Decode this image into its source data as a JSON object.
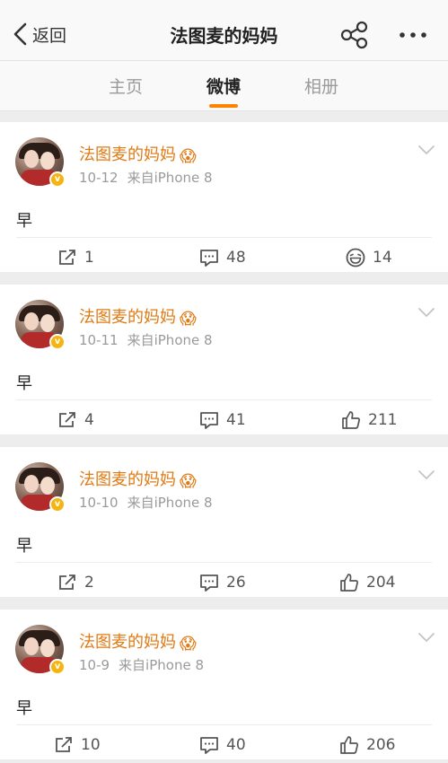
{
  "nav": {
    "back_label": "返回",
    "title": "法图麦的妈妈",
    "share_icon": "share-icon",
    "more_label": "•••"
  },
  "tabs": [
    {
      "label": "主页",
      "active": false
    },
    {
      "label": "微博",
      "active": true
    },
    {
      "label": "相册",
      "active": false
    }
  ],
  "accent_color": "#ff8200",
  "username_color": "#e07a14",
  "posts": [
    {
      "author": "法图麦的妈妈",
      "emoji": "😱",
      "date": "10-12",
      "source": "来自iPhone 8",
      "text": "早",
      "reposts": "1",
      "comments": "48",
      "likes": "14",
      "like_icon": "laugh-icon"
    },
    {
      "author": "法图麦的妈妈",
      "emoji": "😱",
      "date": "10-11",
      "source": "来自iPhone 8",
      "text": "早",
      "reposts": "4",
      "comments": "41",
      "likes": "211",
      "like_icon": "thumbs-up-icon"
    },
    {
      "author": "法图麦的妈妈",
      "emoji": "😱",
      "date": "10-10",
      "source": "来自iPhone 8",
      "text": "早",
      "reposts": "2",
      "comments": "26",
      "likes": "204",
      "like_icon": "thumbs-up-icon"
    },
    {
      "author": "法图麦的妈妈",
      "emoji": "😱",
      "date": "10-9",
      "source": "来自iPhone 8",
      "text": "早",
      "reposts": "10",
      "comments": "40",
      "likes": "206",
      "like_icon": "thumbs-up-icon"
    }
  ]
}
